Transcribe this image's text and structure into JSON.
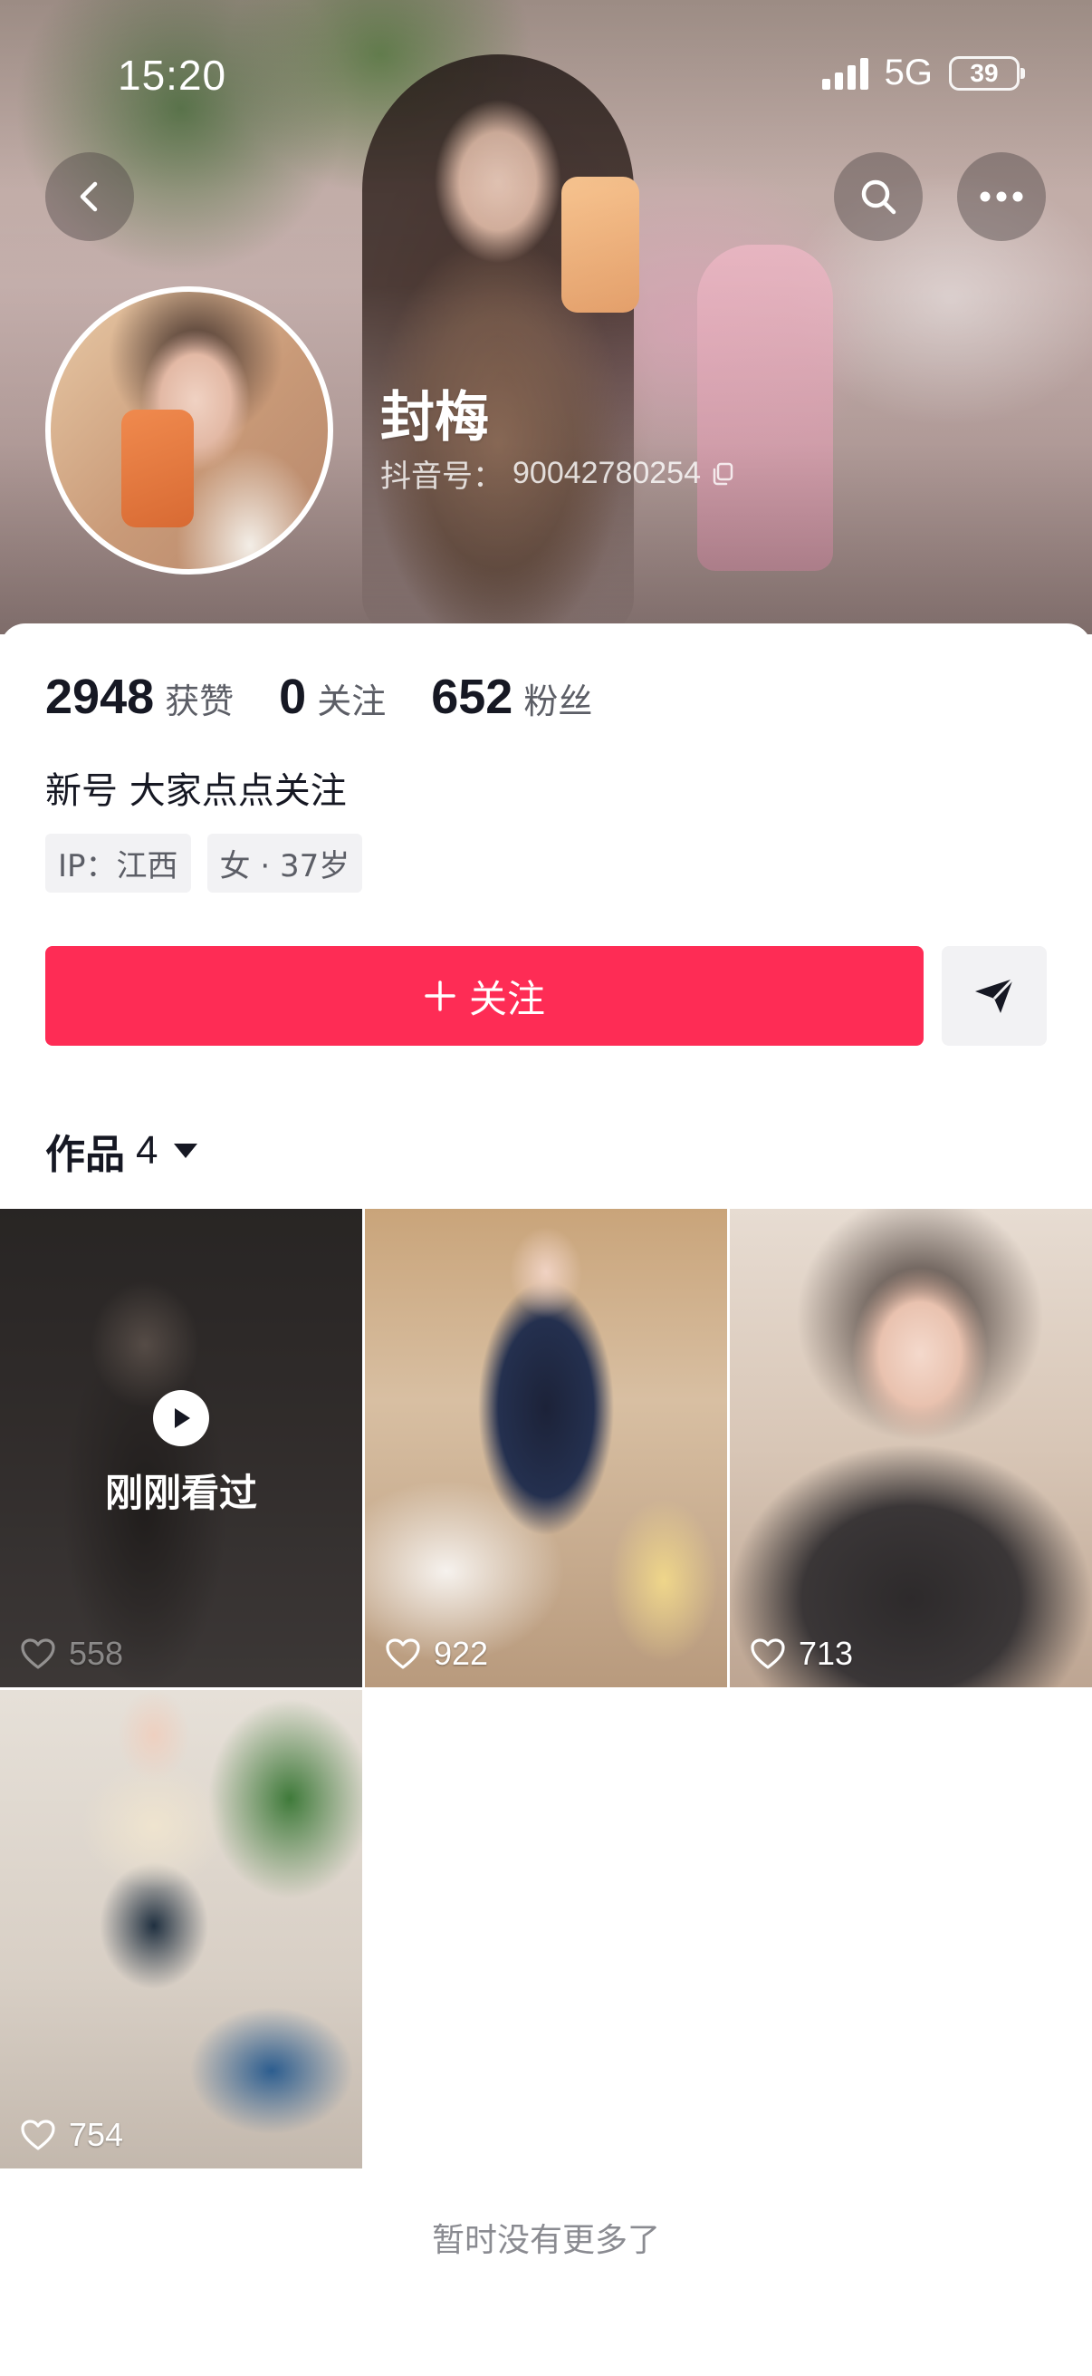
{
  "status_bar": {
    "time": "15:20",
    "network": "5G",
    "battery": "39"
  },
  "header": {
    "back_icon": "chevron-left-icon",
    "search_icon": "search-icon",
    "more_icon": "more-horizontal-icon"
  },
  "profile": {
    "name": "封梅",
    "douyin_id_label": "抖音号：",
    "douyin_id": "90042780254",
    "copy_icon": "copy-icon"
  },
  "stats": [
    {
      "value": "2948",
      "label": "获赞"
    },
    {
      "value": "0",
      "label": "关注"
    },
    {
      "value": "652",
      "label": "粉丝"
    }
  ],
  "bio": "新号 大家点点关注",
  "tags": [
    "IP：江西",
    "女 · 37岁"
  ],
  "actions": {
    "follow_label": "关注",
    "follow_icon": "plus-icon",
    "share_icon": "send-icon"
  },
  "works_tab": {
    "label": "作品",
    "count": "4"
  },
  "videos": [
    {
      "likes": "558",
      "recent_label": "刚刚看过"
    },
    {
      "likes": "922"
    },
    {
      "likes": "713"
    },
    {
      "likes": "754"
    }
  ],
  "footer_text": "暂时没有更多了",
  "colors": {
    "accent": "#fe2c55",
    "text": "#161823",
    "secondary": "#5c5e66"
  }
}
